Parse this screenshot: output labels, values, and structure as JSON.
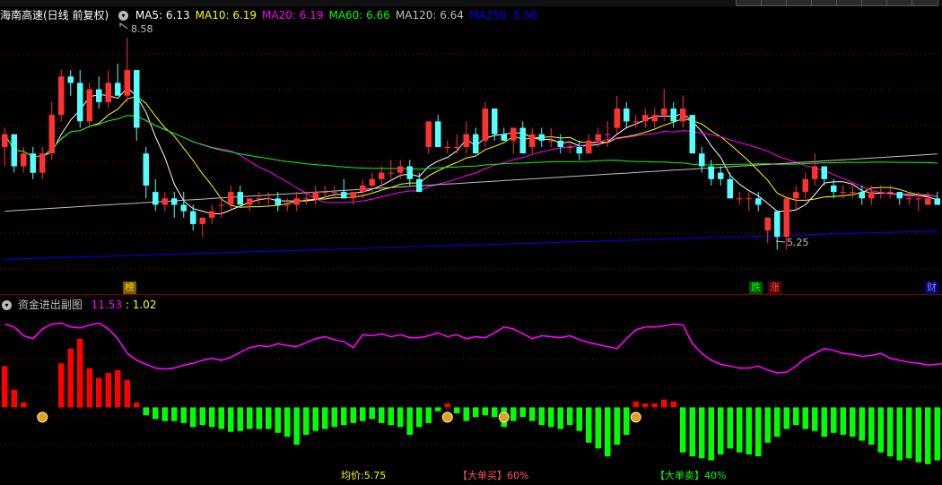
{
  "stock_name": "海南高速(日线 前复权)",
  "toolbar_count": 8,
  "ma_legend": [
    {
      "label": "MA5: 6.13",
      "color": "#ffffff"
    },
    {
      "label": "MA10: 6.19",
      "color": "#ffff00"
    },
    {
      "label": "MA20: 6.19",
      "color": "#ff00ff"
    },
    {
      "label": "MA60: 6.66",
      "color": "#00ff00"
    },
    {
      "label": "MA120: 6.64",
      "color": "#c0c0c0"
    },
    {
      "label": "MA250: 5.56",
      "color": "#0000ff"
    }
  ],
  "high_marker": "8.58",
  "low_marker": "5.25",
  "badges": {
    "bang": "榜",
    "die": "跌",
    "zhang": "涨",
    "cai": "财"
  },
  "sub_panel": {
    "title": "资金进出副图",
    "v1": "11.53",
    "v2": "1.02"
  },
  "footer": {
    "avg": "均价:5.75",
    "big_buy": "【大单买】60%",
    "big_sell": "【大单卖】40%"
  },
  "colors": {
    "up": "#ff3232",
    "down": "#54ffff",
    "bar_up": "#ff0000",
    "bar_down": "#00ff00",
    "fund_line": "#ff00ff"
  },
  "chart_data": {
    "type": "candlestick",
    "y_range": [
      5.0,
      8.8
    ],
    "candles": [
      [
        6.9,
        7.2,
        6.6,
        7.1
      ],
      [
        7.1,
        7.1,
        6.5,
        6.6
      ],
      [
        6.6,
        6.9,
        6.5,
        6.8
      ],
      [
        6.8,
        6.9,
        6.4,
        6.5
      ],
      [
        6.5,
        6.9,
        6.4,
        6.8
      ],
      [
        6.8,
        7.6,
        6.7,
        7.4
      ],
      [
        7.4,
        8.1,
        7.3,
        8.0
      ],
      [
        8.0,
        8.1,
        7.7,
        7.9
      ],
      [
        7.9,
        8.1,
        7.2,
        7.3
      ],
      [
        7.3,
        7.9,
        7.2,
        7.8
      ],
      [
        7.8,
        8.0,
        7.5,
        7.6
      ],
      [
        7.6,
        8.1,
        7.5,
        7.9
      ],
      [
        7.9,
        8.2,
        7.7,
        7.7
      ],
      [
        7.7,
        8.6,
        7.6,
        8.1
      ],
      [
        8.1,
        8.1,
        7.0,
        7.2
      ],
      [
        6.8,
        6.9,
        6.1,
        6.3
      ],
      [
        6.2,
        6.4,
        5.9,
        6.0
      ],
      [
        6.0,
        6.2,
        5.9,
        6.1
      ],
      [
        6.1,
        6.2,
        5.8,
        6.0
      ],
      [
        6.0,
        6.2,
        5.8,
        5.9
      ],
      [
        5.9,
        6.0,
        5.6,
        5.7
      ],
      [
        5.7,
        5.8,
        5.5,
        5.8
      ],
      [
        5.8,
        6.0,
        5.7,
        5.9
      ],
      [
        6.0,
        6.1,
        5.8,
        6.0
      ],
      [
        6.0,
        6.3,
        5.9,
        6.2
      ],
      [
        6.2,
        6.3,
        6.0,
        6.0
      ],
      [
        6.0,
        6.1,
        5.9,
        6.1
      ],
      [
        6.1,
        6.2,
        6.0,
        6.1
      ],
      [
        6.1,
        6.2,
        6.0,
        6.1
      ],
      [
        6.1,
        6.2,
        5.9,
        6.0
      ],
      [
        6.0,
        6.1,
        5.9,
        6.0
      ],
      [
        6.0,
        6.2,
        5.9,
        6.1
      ],
      [
        6.1,
        6.2,
        6.0,
        6.1
      ],
      [
        6.1,
        6.3,
        6.0,
        6.2
      ],
      [
        6.2,
        6.3,
        6.1,
        6.2
      ],
      [
        6.2,
        6.3,
        6.1,
        6.2
      ],
      [
        6.2,
        6.4,
        6.1,
        6.1
      ],
      [
        6.1,
        6.2,
        6.0,
        6.2
      ],
      [
        6.2,
        6.4,
        6.1,
        6.3
      ],
      [
        6.3,
        6.5,
        6.2,
        6.4
      ],
      [
        6.4,
        6.6,
        6.3,
        6.5
      ],
      [
        6.5,
        6.7,
        6.4,
        6.5
      ],
      [
        6.5,
        6.7,
        6.4,
        6.6
      ],
      [
        6.6,
        6.7,
        6.3,
        6.4
      ],
      [
        6.4,
        6.5,
        6.2,
        6.2
      ],
      [
        6.9,
        7.3,
        6.8,
        7.3
      ],
      [
        7.3,
        7.4,
        6.9,
        6.9
      ],
      [
        6.9,
        7.0,
        6.8,
        6.9
      ],
      [
        6.9,
        7.1,
        6.8,
        6.9
      ],
      [
        6.9,
        7.3,
        6.8,
        7.1
      ],
      [
        7.1,
        7.2,
        6.8,
        6.8
      ],
      [
        7.0,
        7.6,
        6.9,
        7.5
      ],
      [
        7.5,
        7.5,
        7.0,
        7.1
      ],
      [
        7.1,
        7.2,
        7.0,
        7.0
      ],
      [
        7.0,
        7.2,
        6.8,
        7.2
      ],
      [
        7.2,
        7.3,
        6.8,
        6.8
      ],
      [
        6.9,
        7.2,
        6.8,
        7.1
      ],
      [
        7.1,
        7.2,
        6.9,
        7.0
      ],
      [
        7.0,
        7.2,
        6.9,
        7.0
      ],
      [
        7.0,
        7.1,
        6.8,
        6.9
      ],
      [
        6.9,
        7.0,
        6.8,
        6.9
      ],
      [
        6.9,
        7.0,
        6.7,
        6.8
      ],
      [
        6.8,
        7.1,
        6.8,
        7.0
      ],
      [
        7.0,
        7.2,
        6.9,
        7.1
      ],
      [
        7.1,
        7.3,
        6.9,
        7.1
      ],
      [
        7.2,
        7.7,
        7.1,
        7.5
      ],
      [
        7.5,
        7.6,
        7.2,
        7.3
      ],
      [
        7.3,
        7.4,
        7.2,
        7.3
      ],
      [
        7.3,
        7.5,
        7.2,
        7.4
      ],
      [
        7.3,
        7.5,
        7.2,
        7.4
      ],
      [
        7.4,
        7.8,
        7.3,
        7.5
      ],
      [
        7.5,
        7.6,
        7.2,
        7.3
      ],
      [
        7.3,
        7.7,
        7.2,
        7.5
      ],
      [
        7.4,
        7.4,
        6.8,
        6.8
      ],
      [
        6.8,
        6.9,
        6.5,
        6.6
      ],
      [
        6.6,
        6.7,
        6.3,
        6.4
      ],
      [
        6.5,
        6.6,
        6.3,
        6.4
      ],
      [
        6.4,
        6.5,
        6.1,
        6.1
      ],
      [
        6.1,
        6.2,
        6.0,
        6.1
      ],
      [
        6.1,
        6.2,
        5.9,
        6.1
      ],
      [
        6.1,
        6.2,
        5.9,
        6.0
      ],
      [
        5.6,
        5.8,
        5.4,
        5.8
      ],
      [
        5.9,
        5.9,
        5.3,
        5.5
      ],
      [
        5.5,
        6.1,
        5.3,
        6.1
      ],
      [
        6.1,
        6.3,
        5.9,
        6.2
      ],
      [
        6.2,
        6.5,
        6.1,
        6.4
      ],
      [
        6.4,
        6.8,
        6.3,
        6.6
      ],
      [
        6.6,
        6.6,
        6.3,
        6.4
      ],
      [
        6.3,
        6.4,
        6.1,
        6.2
      ],
      [
        6.2,
        6.3,
        6.1,
        6.2
      ],
      [
        6.2,
        6.3,
        6.1,
        6.2
      ],
      [
        6.2,
        6.3,
        6.0,
        6.1
      ],
      [
        6.1,
        6.3,
        6.0,
        6.2
      ],
      [
        6.2,
        6.3,
        6.1,
        6.2
      ],
      [
        6.2,
        6.3,
        6.1,
        6.2
      ],
      [
        6.2,
        6.2,
        6.0,
        6.1
      ],
      [
        6.1,
        6.2,
        6.0,
        6.1
      ],
      [
        6.1,
        6.2,
        5.9,
        6.1
      ],
      [
        6.0,
        6.2,
        6.0,
        6.1
      ],
      [
        6.1,
        6.2,
        6.0,
        6.0
      ]
    ],
    "fund_line": [
      85,
      82,
      73,
      70,
      80,
      85,
      86,
      82,
      81,
      84,
      86,
      80,
      70,
      55,
      48,
      44,
      40,
      39,
      40,
      43,
      45,
      48,
      50,
      48,
      51,
      56,
      61,
      63,
      62,
      65,
      63,
      62,
      66,
      70,
      72,
      69,
      67,
      61,
      74,
      73,
      75,
      72,
      74,
      71,
      71,
      73,
      76,
      72,
      74,
      70,
      72,
      71,
      76,
      82,
      80,
      75,
      70,
      73,
      72,
      71,
      73,
      69,
      66,
      64,
      62,
      60,
      70,
      79,
      82,
      82,
      83,
      85,
      84,
      65,
      55,
      48,
      44,
      42,
      40,
      40,
      42,
      38,
      35,
      36,
      42,
      50,
      55,
      60,
      58,
      55,
      54,
      52,
      53,
      55,
      50,
      48,
      46,
      45,
      43,
      44,
      45
    ],
    "fund_bars": [
      42,
      18,
      5,
      0,
      0,
      0,
      45,
      60,
      70,
      40,
      30,
      35,
      38,
      28,
      5,
      -8,
      -12,
      -14,
      -14,
      -16,
      -20,
      -18,
      -20,
      -22,
      -25,
      -24,
      -22,
      -22,
      -22,
      -26,
      -30,
      -38,
      -28,
      -24,
      -22,
      -20,
      -18,
      -16,
      -14,
      -12,
      -16,
      -18,
      -20,
      -28,
      -20,
      -16,
      -4,
      4,
      -6,
      -14,
      -10,
      -8,
      -10,
      -20,
      -14,
      -10,
      -14,
      -18,
      -20,
      -22,
      -18,
      -24,
      -36,
      -42,
      -50,
      -38,
      -28,
      6,
      4,
      4,
      8,
      6,
      -46,
      -50,
      -52,
      -54,
      -48,
      -42,
      -46,
      -48,
      -50,
      -36,
      -30,
      -22,
      -18,
      -22,
      -24,
      -30,
      -26,
      -28,
      -30,
      -34,
      -38,
      -46,
      -50,
      -54,
      -52,
      -56,
      -58,
      -54,
      -56
    ],
    "fund_y_range": [
      -60,
      100
    ]
  }
}
